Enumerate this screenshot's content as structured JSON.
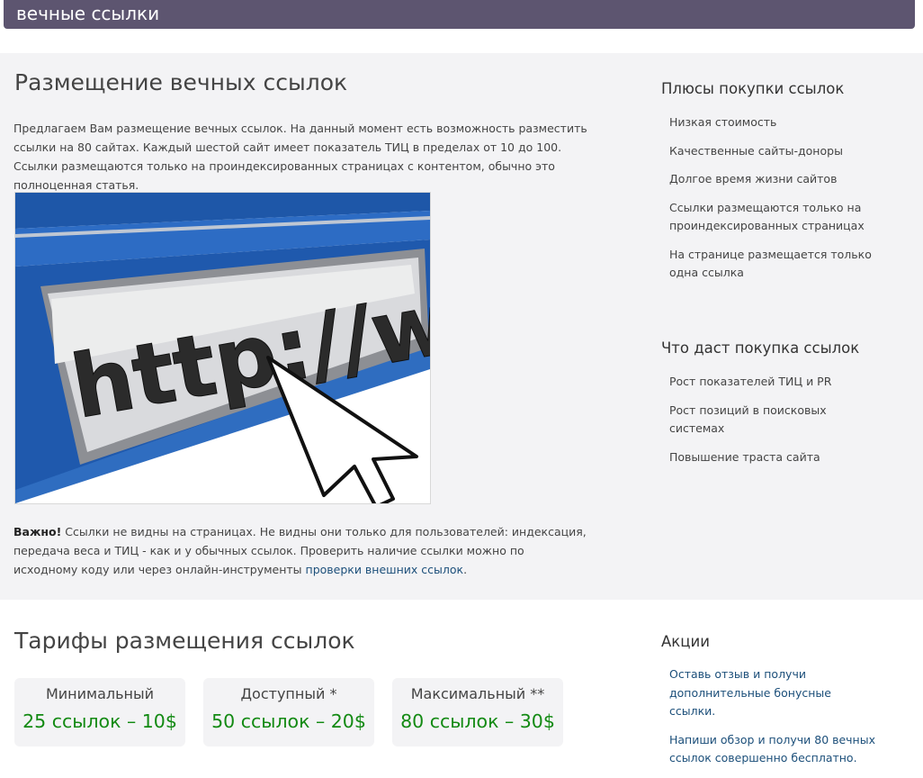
{
  "header": {
    "brand": "вечные ссылки"
  },
  "main": {
    "title": "Размещение вечных ссылок",
    "intro": "Предлагаем Вам размещение вечных ссылок. На данный момент есть возможность разместить ссылки на 80 сайтах. Каждый шестой сайт имеет показатель ТИЦ в пределах от 10 до 100. Ссылки размещаются только на проиндексированных страницах с контентом, обычно это полноценная статья.",
    "hero_text": "http://www.",
    "note": {
      "bold": "Важно!",
      "text": " Ссылки не видны на страницах. Не видны они только для пользователей: индексация, передача веса и ТИЦ - как и у обычных ссылок. Проверить наличие ссылки можно по исходному коду или через онлайн-инструменты ",
      "link": "проверки внешних ссылок",
      "end": "."
    }
  },
  "sidebar": {
    "pros_title": "Плюсы покупки ссылок",
    "pros": [
      "Низкая стоимость",
      "Качественные сайты-доноры",
      "Долгое время жизни сайтов",
      "Ссылки размещаются только на проиндексированных страницах",
      "На странице размещается только одна ссылка"
    ],
    "gains_title": "Что даст покупка ссылок",
    "gains": [
      "Рост показателей ТИЦ и PR",
      "Рост позиций в поисковых системах",
      "Повышение траста сайта"
    ],
    "promo_title": "Акции",
    "promos": [
      "Оставь отзыв и получи дополнительные бонусные ссылки.",
      "Напиши обзор и получи 80 вечных ссылок совершенно бесплатно."
    ]
  },
  "tariffs": {
    "title": "Тарифы размещения ссылок",
    "plans": [
      {
        "name": "Минимальный",
        "price": "25 ссылок – 10$"
      },
      {
        "name": "Доступный *",
        "price": "50 ссылок – 20$"
      },
      {
        "name": "Максимальный **",
        "price": "80 ссылок – 30$"
      }
    ]
  }
}
